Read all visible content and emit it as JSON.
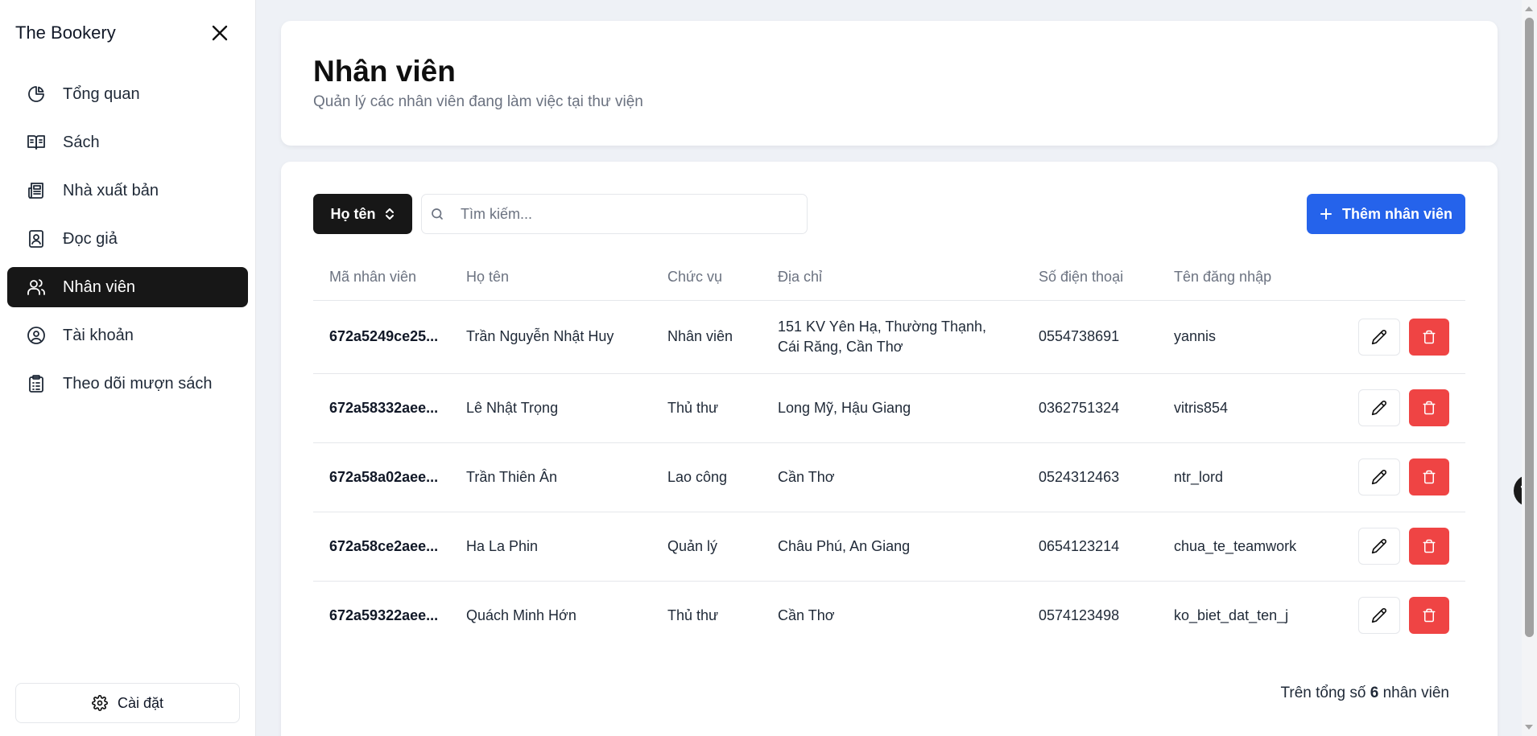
{
  "sidebar": {
    "brand": "The Bookery",
    "items": [
      {
        "label": "Tổng quan",
        "icon": "pie-chart-icon",
        "active": false
      },
      {
        "label": "Sách",
        "icon": "book-open-icon",
        "active": false
      },
      {
        "label": "Nhà xuất bản",
        "icon": "newspaper-icon",
        "active": false
      },
      {
        "label": "Đọc giả",
        "icon": "contact-card-icon",
        "active": false
      },
      {
        "label": "Nhân viên",
        "icon": "users-icon",
        "active": true
      },
      {
        "label": "Tài khoản",
        "icon": "user-circle-icon",
        "active": false
      },
      {
        "label": "Theo dõi mượn sách",
        "icon": "clipboard-list-icon",
        "active": false
      }
    ],
    "settings_label": "Cài đặt"
  },
  "header": {
    "title": "Nhân viên",
    "subtitle": "Quản lý các nhân viên đang làm việc tại thư viện"
  },
  "toolbar": {
    "sort_label": "Họ tên",
    "search_placeholder": "Tìm kiếm...",
    "search_value": "",
    "add_label": "Thêm nhân viên"
  },
  "table": {
    "columns": [
      "Mã nhân viên",
      "Họ tên",
      "Chức vụ",
      "Địa chỉ",
      "Số điện thoại",
      "Tên đăng nhập"
    ],
    "rows": [
      {
        "id": "672a5249ce25...",
        "name": "Trần Nguyễn Nhật Huy",
        "role": "Nhân viên",
        "address": "151 KV Yên Hạ, Thường Thạnh, Cái Răng, Cần Thơ",
        "phone": "0554738691",
        "username": "yannis"
      },
      {
        "id": "672a58332aee...",
        "name": "Lê Nhật Trọng",
        "role": "Thủ thư",
        "address": "Long Mỹ, Hậu Giang",
        "phone": "0362751324",
        "username": "vitris854"
      },
      {
        "id": "672a58a02aee...",
        "name": "Trần Thiên Ân",
        "role": "Lao công",
        "address": "Cần Thơ",
        "phone": "0524312463",
        "username": "ntr_lord"
      },
      {
        "id": "672a58ce2aee...",
        "name": "Ha La Phin",
        "role": "Quản lý",
        "address": "Châu Phú, An Giang",
        "phone": "0654123214",
        "username": "chua_te_teamwork"
      },
      {
        "id": "672a59322aee...",
        "name": "Quách Minh Hớn",
        "role": "Thủ thư",
        "address": "Cần Thơ",
        "phone": "0574123498",
        "username": "ko_biet_dat_ten_j"
      }
    ]
  },
  "footer": {
    "total_prefix": "Trên tổng số",
    "total_count": "6",
    "total_suffix": "nhân viên"
  },
  "colors": {
    "accent": "#2563eb",
    "danger": "#ef4444",
    "active_nav": "#171717",
    "page_bg": "#eef1f6"
  }
}
